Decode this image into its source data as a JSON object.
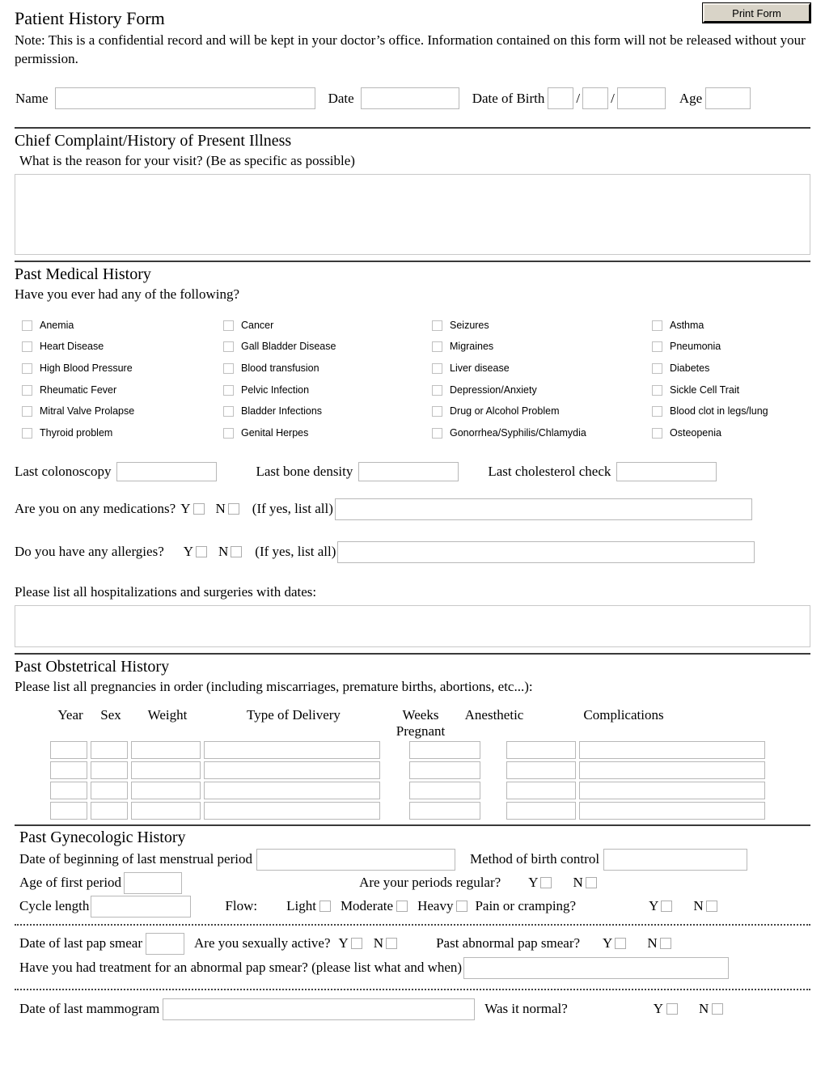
{
  "header": {
    "title": "Patient History Form",
    "note": "Note: This is a confidential record and will be kept in your doctor’s office. Information contained on this form will not be released without your permission.",
    "print_button": "Print Form"
  },
  "identity": {
    "name_label": "Name",
    "name_value": "",
    "date_label": "Date",
    "date_value": "",
    "dob_label": "Date of Birth",
    "dob_month": "",
    "dob_sep1": "/",
    "dob_day": "",
    "dob_sep2": "/",
    "dob_year": "",
    "age_label": "Age",
    "age_value": ""
  },
  "chief_complaint": {
    "heading": "Chief Complaint/History of Present Illness",
    "prompt": "What is the reason for your visit? (Be as specific as possible)",
    "value": ""
  },
  "past_medical": {
    "heading": "Past Medical History",
    "prompt": "Have you ever had any of the following?",
    "columns": [
      [
        "Anemia",
        "Heart Disease",
        "High Blood Pressure",
        "Rheumatic Fever",
        "Mitral Valve Prolapse",
        "Thyroid problem"
      ],
      [
        "Cancer",
        "Gall Bladder Disease",
        "Blood transfusion",
        "Pelvic Infection",
        "Bladder Infections",
        "Genital Herpes"
      ],
      [
        "Seizures",
        "Migraines",
        "Liver disease",
        "Depression/Anxiety",
        "Drug or Alcohol Problem",
        "Gonorrhea/Syphilis/Chlamydia"
      ],
      [
        "Asthma",
        "Pneumonia",
        "Diabetes",
        "Sickle Cell Trait",
        "Blood clot in legs/lung",
        "Osteopenia"
      ]
    ],
    "colonoscopy_label": "Last colonoscopy",
    "colonoscopy_value": "",
    "bone_density_label": "Last bone density",
    "bone_density_value": "",
    "cholesterol_label": "Last cholesterol check",
    "cholesterol_value": "",
    "medications_label": "Are you on any medications?",
    "medications_yes": "Y",
    "medications_no": "N",
    "medications_hint": "(If yes, list all)",
    "medications_value": "",
    "allergies_label": "Do you have any allergies?",
    "allergies_yes": "Y",
    "allergies_no": "N",
    "allergies_hint": "(If yes, list all)",
    "allergies_value": "",
    "hospitalizations_label": "Please list all hospitalizations and surgeries with dates:",
    "hospitalizations_value": ""
  },
  "past_obstetrical": {
    "heading": "Past Obstetrical History",
    "prompt": "Please list all pregnancies in order (including miscarriages, premature births, abortions, etc...):",
    "headers": [
      "Year",
      "Sex",
      "Weight",
      "Type of Delivery",
      "Weeks Pregnant",
      "Anesthetic",
      "Complications"
    ],
    "rows": [
      [
        "",
        "",
        "",
        "",
        "",
        "",
        ""
      ],
      [
        "",
        "",
        "",
        "",
        "",
        "",
        ""
      ],
      [
        "",
        "",
        "",
        "",
        "",
        "",
        ""
      ],
      [
        "",
        "",
        "",
        "",
        "",
        "",
        ""
      ]
    ]
  },
  "past_gynecologic": {
    "heading": "Past Gynecologic History",
    "lmp_label": "Date of beginning of last menstrual period",
    "lmp_value": "",
    "birth_control_label": "Method of birth control",
    "birth_control_value": "",
    "first_period_label": "Age of first period",
    "first_period_value": "",
    "periods_regular_label": "Are your periods regular?",
    "periods_regular_yes": "Y",
    "periods_regular_no": "N",
    "cycle_length_label": "Cycle length",
    "cycle_length_value": "",
    "flow_label": "Flow:",
    "flow_light": "Light",
    "flow_moderate": "Moderate",
    "flow_heavy": "Heavy",
    "pain_label": "Pain or cramping?",
    "pain_yes": "Y",
    "pain_no": "N",
    "pap_date_label": "Date of last pap smear",
    "pap_date_value": "",
    "sexually_active_label": "Are you sexually active?",
    "sexually_active_yes": "Y",
    "sexually_active_no": "N",
    "abnormal_pap_label": "Past abnormal pap smear?",
    "abnormal_pap_yes": "Y",
    "abnormal_pap_no": "N",
    "treatment_label": "Have you had treatment for an abnormal pap smear? (please list what and when)",
    "treatment_value": "",
    "mammogram_label": "Date of last mammogram",
    "mammogram_value": "",
    "mammogram_normal_label": "Was it normal?",
    "mammogram_normal_yes": "Y",
    "mammogram_normal_no": "N"
  }
}
